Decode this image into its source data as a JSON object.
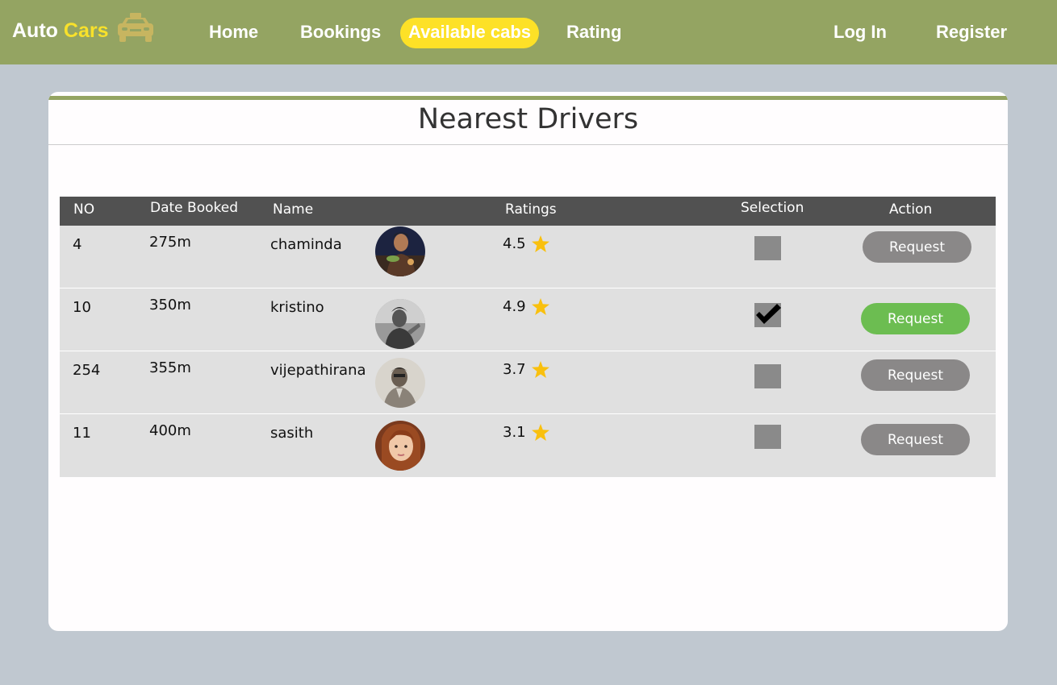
{
  "brand": {
    "name_part1": "Auto",
    "name_part2": "Cars",
    "icon": "taxi-car-icon"
  },
  "nav": {
    "home": "Home",
    "bookings": "Bookings",
    "available_cabs": "Available cabs",
    "rating": "Rating",
    "login": "Log In",
    "register": "Register"
  },
  "card": {
    "title": "Nearest Drivers"
  },
  "table": {
    "headers": {
      "no": "NO",
      "date_booked": "Date Booked",
      "name": "Name",
      "ratings": "Ratings",
      "selection": "Selection",
      "action": "Action"
    },
    "rows": [
      {
        "no": "4",
        "distance": "275m",
        "name": "chaminda",
        "rating": "4.5",
        "selected": false,
        "action": "Request"
      },
      {
        "no": "10",
        "distance": "350m",
        "name": "kristino",
        "rating": "4.9",
        "selected": true,
        "action": "Request"
      },
      {
        "no": "254",
        "distance": "355m",
        "name": "vijepathirana",
        "rating": "3.7",
        "selected": false,
        "action": "Request"
      },
      {
        "no": "11",
        "distance": "400m",
        "name": "sasith",
        "rating": "3.1",
        "selected": false,
        "action": "Request"
      }
    ]
  },
  "colors": {
    "navbar": "#94a462",
    "brand_accent": "#f8e12b",
    "active_pill": "#fde127",
    "table_header": "#515151",
    "row_bg": "#e0e0e0",
    "button_gray": "#8a8888",
    "button_green": "#6cbd51",
    "star": "#f9c00e"
  }
}
